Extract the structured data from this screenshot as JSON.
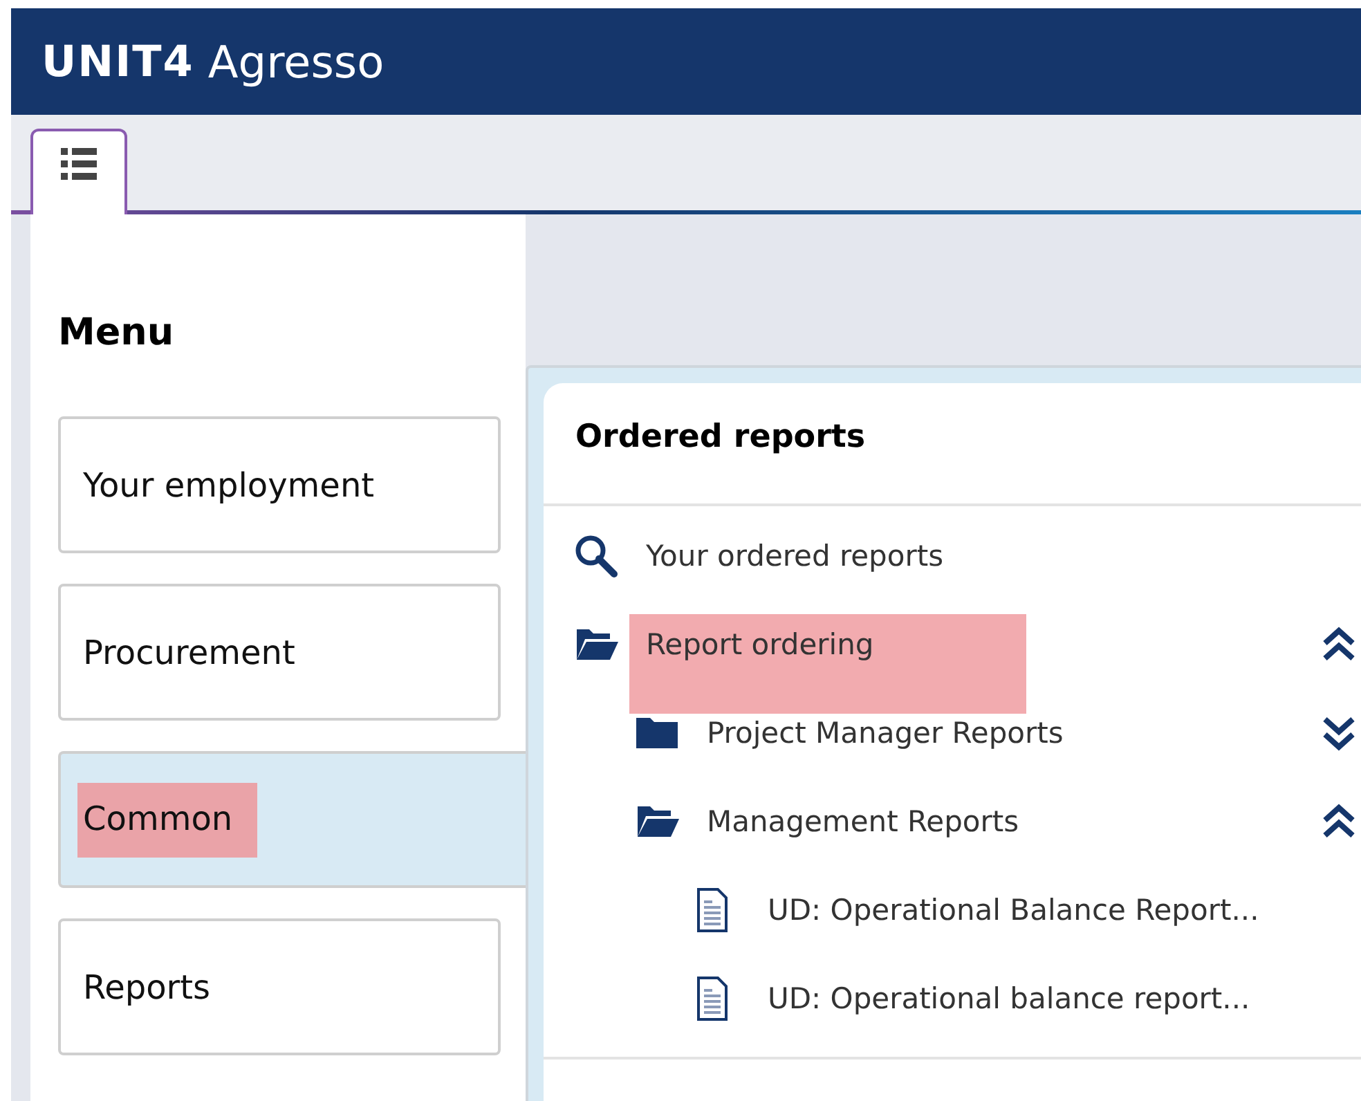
{
  "header": {
    "logo_mark": "UNIT4",
    "logo_text": "Agresso"
  },
  "tabs": [
    {
      "kind": "menu",
      "selected": true
    }
  ],
  "menu": {
    "title": "Menu",
    "items": [
      {
        "label": "Your employment",
        "selected": false,
        "highlighted": false
      },
      {
        "label": "Procurement",
        "selected": false,
        "highlighted": false
      },
      {
        "label": "Common",
        "selected": true,
        "highlighted": true
      },
      {
        "label": "Reports",
        "selected": false,
        "highlighted": false
      }
    ]
  },
  "panel": {
    "title": "Ordered reports",
    "items": [
      {
        "kind": "search",
        "label": "Your ordered reports",
        "highlighted": false
      },
      {
        "kind": "folder",
        "label": "Report ordering",
        "expanded": true,
        "highlighted": true,
        "children": [
          {
            "kind": "folder",
            "label": "Project Manager Reports",
            "expanded": false,
            "highlighted": false
          },
          {
            "kind": "folder",
            "label": "Management Reports",
            "expanded": true,
            "highlighted": false,
            "children": [
              {
                "kind": "document",
                "label": "UD: Operational Balance Report...",
                "highlighted": false
              },
              {
                "kind": "document",
                "label": "UD: Operational balance report...",
                "highlighted": false
              }
            ]
          }
        ]
      }
    ]
  }
}
